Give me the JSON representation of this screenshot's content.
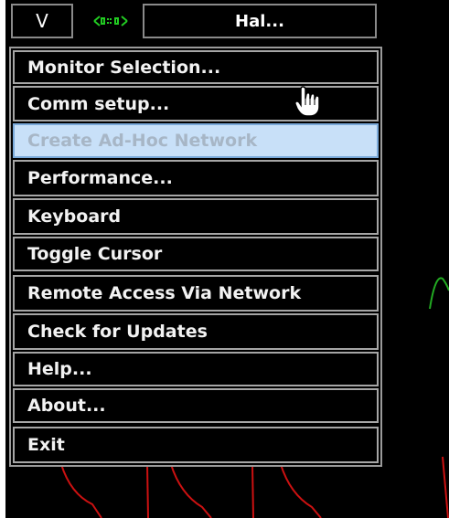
{
  "topbar": {
    "version_label": "V",
    "network_icon": "network-link-icon",
    "patient_label": "Hal..."
  },
  "menu": {
    "items": [
      {
        "label": "Monitor Selection...",
        "state": "enabled"
      },
      {
        "label": "Comm setup...",
        "state": "enabled"
      },
      {
        "label": "Create Ad-Hoc Network",
        "state": "disabled-hovered"
      },
      {
        "label": "Performance...",
        "state": "enabled"
      },
      {
        "label": "Keyboard",
        "state": "enabled"
      },
      {
        "label": "Toggle Cursor",
        "state": "enabled"
      },
      {
        "label": "Remote Access Via Network",
        "state": "enabled"
      },
      {
        "label": "Check for Updates",
        "state": "enabled"
      },
      {
        "label": "Help...",
        "state": "enabled"
      },
      {
        "label": "About...",
        "state": "enabled"
      },
      {
        "label": "Exit",
        "state": "enabled"
      }
    ]
  },
  "colors": {
    "background": "#000000",
    "menu_border": "#a6a6a6",
    "menu_text": "#f2f2f2",
    "disabled_highlight": "#c8e0f8",
    "network_icon": "#22cc22",
    "waveform_red": "#cc1111",
    "waveform_green": "#22aa22"
  }
}
